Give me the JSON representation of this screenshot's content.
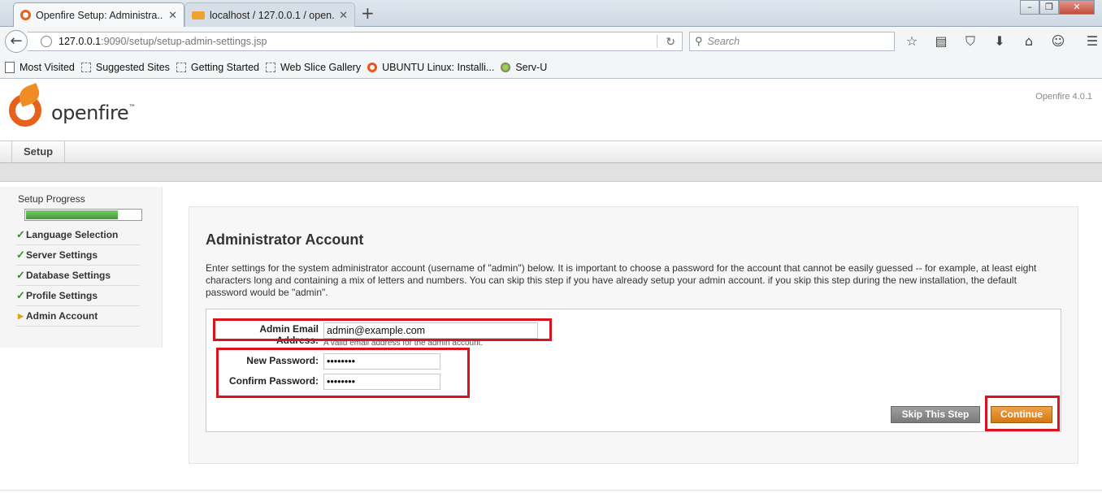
{
  "browser": {
    "tabs": [
      {
        "title": "Openfire Setup: Administra...",
        "active": true
      },
      {
        "title": "localhost / 127.0.0.1 / open...",
        "active": false
      }
    ],
    "url_host": "127.0.0.1",
    "url_path": ":9090/setup/setup-admin-settings.jsp",
    "search_placeholder": "Search",
    "bookmarks": [
      "Most Visited",
      "Suggested Sites",
      "Getting Started",
      "Web Slice Gallery",
      "UBUNTU Linux: Installi...",
      "Serv-U"
    ]
  },
  "header": {
    "logo_text": "openfire",
    "logo_tm": "™",
    "version": "Openfire 4.0.1",
    "menu_setup": "Setup"
  },
  "sidebar": {
    "heading": "Setup Progress",
    "progress": 0.8,
    "steps": [
      {
        "label": "Language Selection",
        "done": true
      },
      {
        "label": "Server Settings",
        "done": true
      },
      {
        "label": "Database Settings",
        "done": true
      },
      {
        "label": "Profile Settings",
        "done": true
      },
      {
        "label": "Admin Account",
        "done": false
      }
    ]
  },
  "main": {
    "title": "Administrator Account",
    "description": "Enter settings for the system administrator account (username of \"admin\") below. It is important to choose a password for the account that cannot be easily guessed -- for example, at least eight characters long and containing a mix of letters and numbers. You can skip this step if you have already setup your admin account. if you skip this step during the new installation, the default password would be \"admin\".",
    "email_label": "Admin Email Address:",
    "email_value": "admin@example.com",
    "email_hint": "A valid email address for the admin account.",
    "new_password_label": "New Password:",
    "new_password_value": "••••••••",
    "confirm_password_label": "Confirm Password:",
    "confirm_password_value": "••••••••",
    "skip_label": "Skip This Step",
    "continue_label": "Continue"
  },
  "colors": {
    "highlight": "#d9141e",
    "accent": "#e8611a",
    "progress": "#4caf50"
  }
}
